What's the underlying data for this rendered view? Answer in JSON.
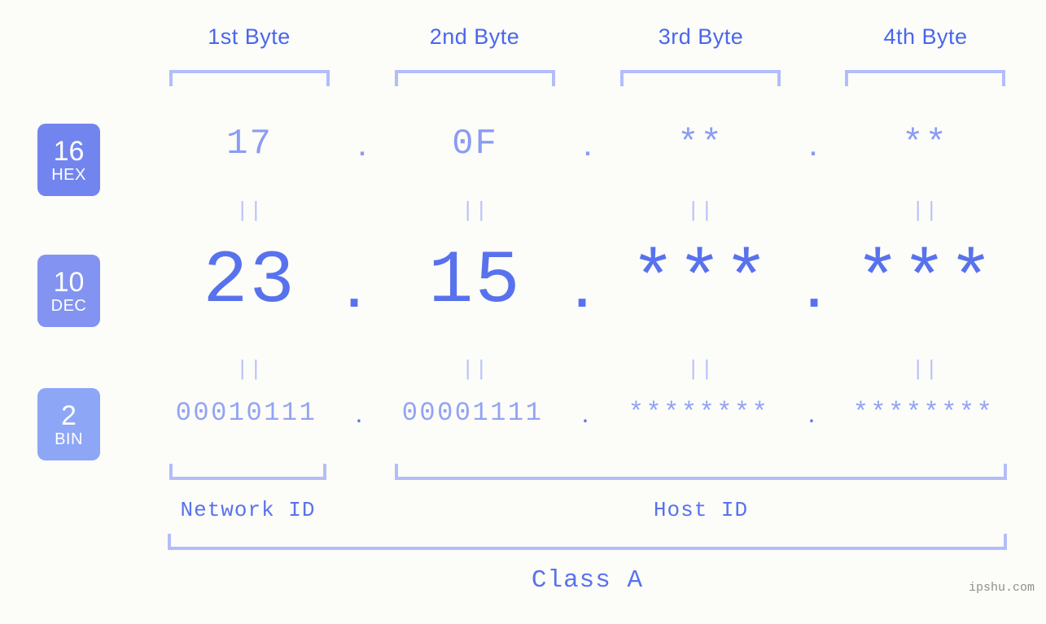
{
  "page": {
    "background_color": "#fcfdf8",
    "accent_color": "#5872ee",
    "light_accent_color": "#b3bdfb",
    "watermark": "ipshu.com"
  },
  "byte_headers": [
    {
      "label": "1st Byte"
    },
    {
      "label": "2nd Byte"
    },
    {
      "label": "3rd Byte"
    },
    {
      "label": "4th Byte"
    }
  ],
  "rows": [
    {
      "id": "hex",
      "badge_number": "16",
      "badge_label": "HEX",
      "badge_color": "#7285ef",
      "values": [
        "17",
        "0F",
        "**",
        "**"
      ],
      "separators": [
        ".",
        ".",
        "."
      ]
    },
    {
      "id": "dec",
      "badge_number": "10",
      "badge_label": "DEC",
      "badge_color": "#8293f2",
      "values": [
        "23",
        "15",
        "***",
        "***"
      ],
      "separators": [
        ".",
        ".",
        "."
      ]
    },
    {
      "id": "bin",
      "badge_number": "2",
      "badge_label": "BIN",
      "badge_color": "#8ea6f6",
      "values": [
        "00010111",
        "00001111",
        "********",
        "********"
      ],
      "separators": [
        ".",
        ".",
        "."
      ]
    }
  ],
  "equality_connectors": {
    "symbol": "||",
    "rows": [
      [
        "||",
        "||",
        "||",
        "||"
      ],
      [
        "||",
        "||",
        "||",
        "||"
      ]
    ]
  },
  "sections": {
    "network_id": "Network ID",
    "host_id": "Host ID",
    "class": "Class A"
  }
}
